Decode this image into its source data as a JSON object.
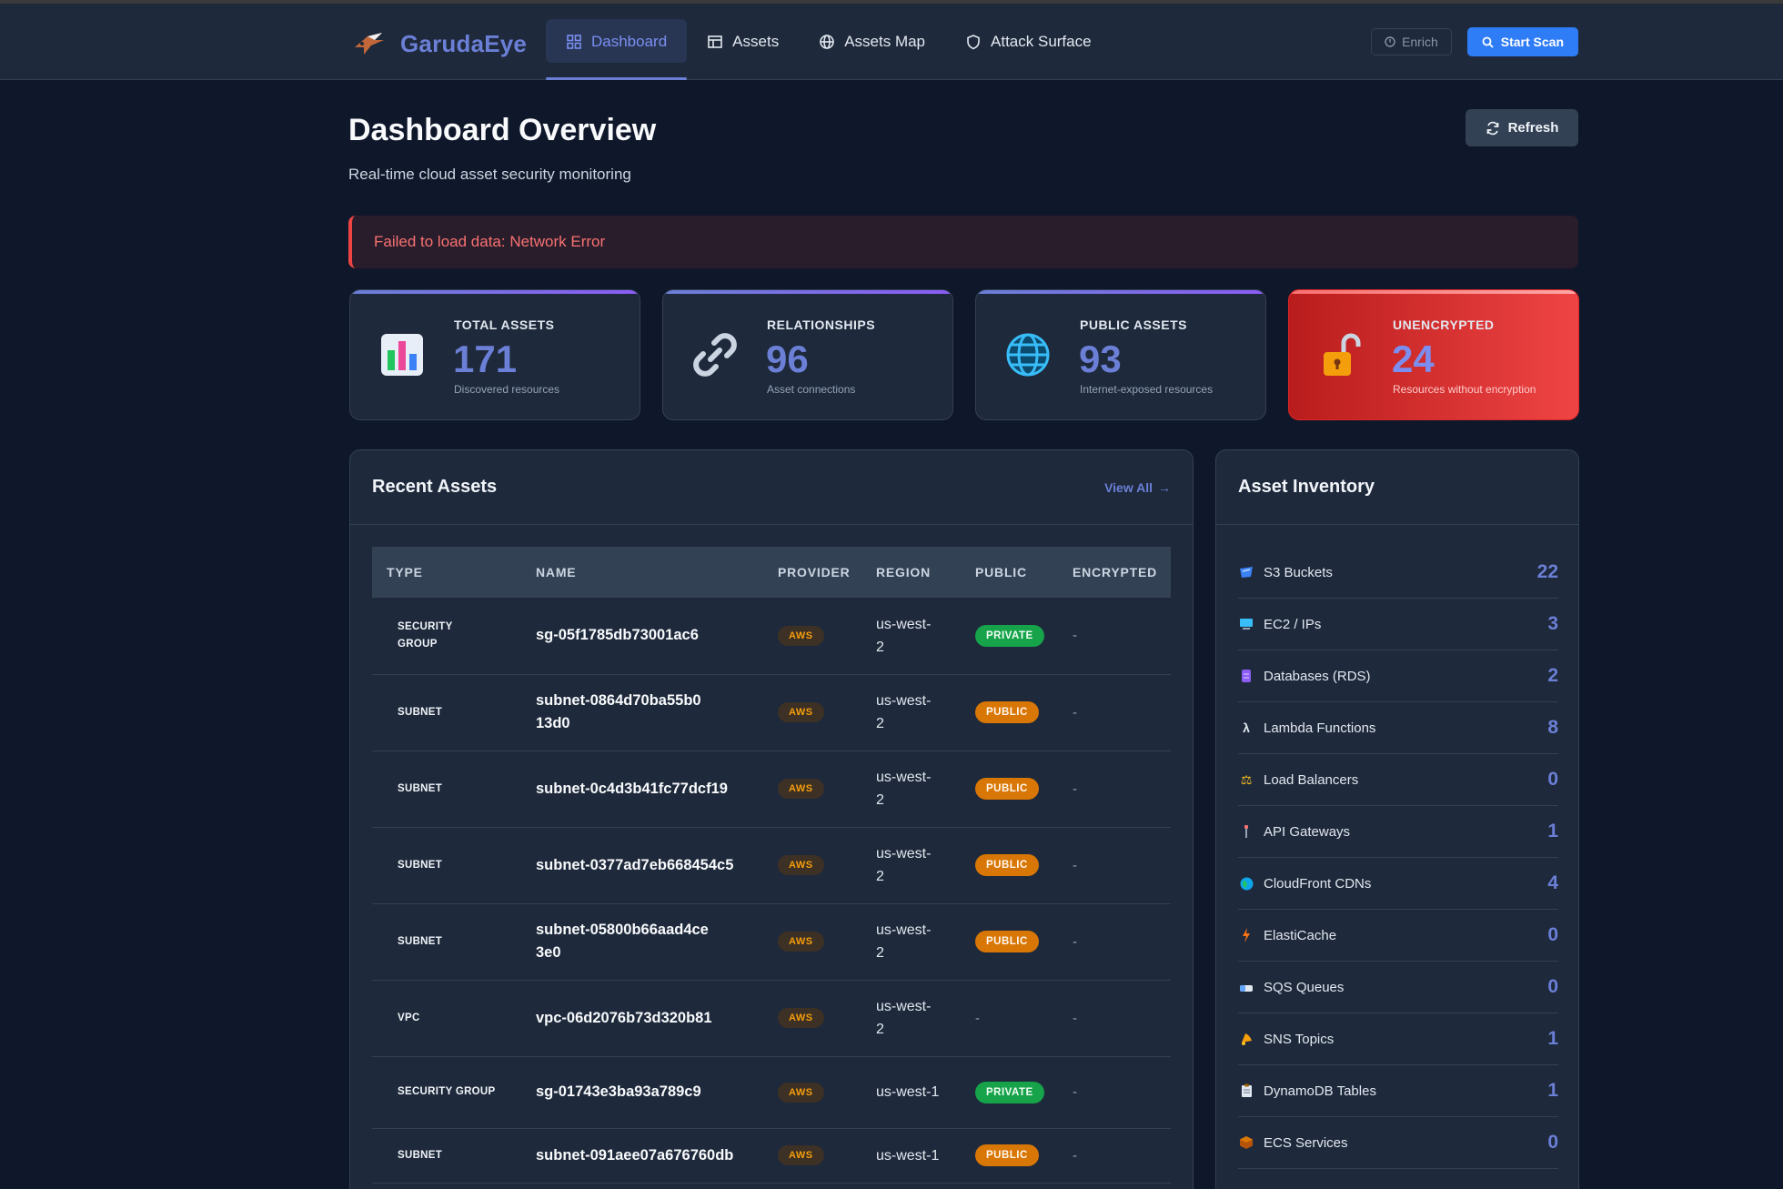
{
  "app": {
    "name": "GarudaEye"
  },
  "nav": {
    "items": [
      {
        "label": "Dashboard",
        "icon": "grid-icon",
        "active": true
      },
      {
        "label": "Assets",
        "icon": "table-icon",
        "active": false
      },
      {
        "label": "Assets Map",
        "icon": "globe-icon",
        "active": false
      },
      {
        "label": "Attack Surface",
        "icon": "shield-icon",
        "active": false
      }
    ],
    "enrich_label": "Enrich",
    "scan_label": "Start Scan"
  },
  "page": {
    "title": "Dashboard Overview",
    "subtitle": "Real-time cloud asset security monitoring",
    "refresh_label": "Refresh",
    "error": "Failed to load data: Network Error"
  },
  "stats": [
    {
      "label": "TOTAL ASSETS",
      "value": "171",
      "desc": "Discovered resources",
      "icon": "bar-chart-icon"
    },
    {
      "label": "RELATIONSHIPS",
      "value": "96",
      "desc": "Asset connections",
      "icon": "link-icon"
    },
    {
      "label": "PUBLIC ASSETS",
      "value": "93",
      "desc": "Internet-exposed resources",
      "icon": "globe-icon"
    },
    {
      "label": "UNENCRYPTED",
      "value": "24",
      "desc": "Resources without encryption",
      "icon": "unlocked-padlock-icon"
    }
  ],
  "recent": {
    "title": "Recent Assets",
    "view_all": "View All",
    "columns": [
      "TYPE",
      "NAME",
      "PROVIDER",
      "REGION",
      "PUBLIC",
      "ENCRYPTED"
    ],
    "rows": [
      {
        "type": "SECURITY GROUP",
        "name": "sg-05f1785db73001ac6",
        "provider": "AWS",
        "region": "us-west-2",
        "public": "PRIVATE",
        "encrypted": "-"
      },
      {
        "type": "SUBNET",
        "name": "subnet-0864d70ba55b013d0",
        "provider": "AWS",
        "region": "us-west-2",
        "public": "PUBLIC",
        "encrypted": "-"
      },
      {
        "type": "SUBNET",
        "name": "subnet-0c4d3b41fc77dcf19",
        "provider": "AWS",
        "region": "us-west-2",
        "public": "PUBLIC",
        "encrypted": "-"
      },
      {
        "type": "SUBNET",
        "name": "subnet-0377ad7eb668454c5",
        "provider": "AWS",
        "region": "us-west-2",
        "public": "PUBLIC",
        "encrypted": "-"
      },
      {
        "type": "SUBNET",
        "name": "subnet-05800b66aad4ce3e0",
        "provider": "AWS",
        "region": "us-west-2",
        "public": "PUBLIC",
        "encrypted": "-"
      },
      {
        "type": "VPC",
        "name": "vpc-06d2076b73d320b81",
        "provider": "AWS",
        "region": "us-west-2",
        "public": "-",
        "encrypted": "-"
      },
      {
        "type": "SECURITY GROUP",
        "name": "sg-01743e3ba93a789c9",
        "provider": "AWS",
        "region": "us-west-1",
        "public": "PRIVATE",
        "encrypted": "-"
      },
      {
        "type": "SUBNET",
        "name": "subnet-091aee07a676760db",
        "provider": "AWS",
        "region": "us-west-1",
        "public": "PUBLIC",
        "encrypted": "-"
      }
    ]
  },
  "inventory": {
    "title": "Asset Inventory",
    "items": [
      {
        "label": "S3 Buckets",
        "count": "22",
        "icon": "bucket-icon"
      },
      {
        "label": "EC2 / IPs",
        "count": "3",
        "icon": "computer-icon"
      },
      {
        "label": "Databases (RDS)",
        "count": "2",
        "icon": "database-icon"
      },
      {
        "label": "Lambda Functions",
        "count": "8",
        "icon": "lambda-icon"
      },
      {
        "label": "Load Balancers",
        "count": "0",
        "icon": "balance-scale-icon"
      },
      {
        "label": "API Gateways",
        "count": "1",
        "icon": "gateway-icon"
      },
      {
        "label": "CloudFront CDNs",
        "count": "4",
        "icon": "earth-icon"
      },
      {
        "label": "ElastiCache",
        "count": "0",
        "icon": "lightning-icon"
      },
      {
        "label": "SQS Queues",
        "count": "0",
        "icon": "mailbox-icon"
      },
      {
        "label": "SNS Topics",
        "count": "1",
        "icon": "bell-icon"
      },
      {
        "label": "DynamoDB Tables",
        "count": "1",
        "icon": "clipboard-icon"
      },
      {
        "label": "ECS Services",
        "count": "0",
        "icon": "package-icon"
      }
    ]
  },
  "colors": {
    "background": "#0f172a",
    "surface": "#1e293b",
    "accent": "#6b7fd6",
    "primary_button": "#2f7df6",
    "danger": "#ef4444",
    "success": "#16a34a",
    "warning": "#d97706"
  }
}
